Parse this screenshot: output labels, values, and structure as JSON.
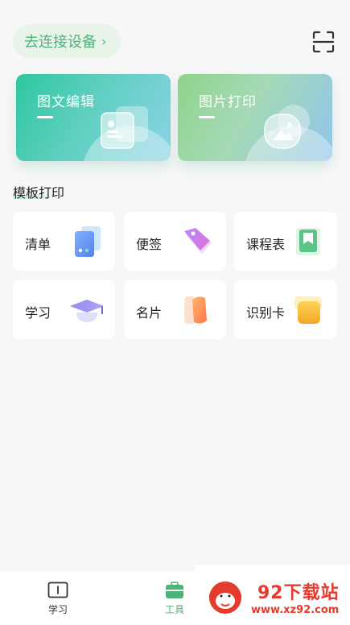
{
  "header": {
    "connect_label": "去连接设备",
    "connect_chevron": "›",
    "scan_icon": "scan-icon"
  },
  "hero": [
    {
      "label": "图文编辑",
      "icon": "photo-card-icon",
      "colors": [
        "#2ec7a0",
        "#8bd3e6"
      ]
    },
    {
      "label": "图片打印",
      "icon": "image-icon",
      "colors": [
        "#8ed48a",
        "#8fc4ec"
      ]
    }
  ],
  "section": {
    "title": "模板打印"
  },
  "templates": [
    {
      "label": "清单",
      "icon": "checklist-icon"
    },
    {
      "label": "便签",
      "icon": "tag-icon"
    },
    {
      "label": "课程表",
      "icon": "bookmark-icon"
    },
    {
      "label": "学习",
      "icon": "graduation-cap-icon"
    },
    {
      "label": "名片",
      "icon": "card-icon"
    },
    {
      "label": "识别卡",
      "icon": "id-card-icon"
    }
  ],
  "bottom_nav": {
    "items": [
      {
        "label": "学习",
        "icon": "study-icon",
        "active": false
      },
      {
        "label": "工具",
        "icon": "toolbox-icon",
        "active": true
      }
    ]
  },
  "watermark": {
    "title": "92下载站",
    "url": "www.xz92.com"
  },
  "colors": {
    "accent": "#4fb378",
    "watermark": "#e53a2e"
  }
}
